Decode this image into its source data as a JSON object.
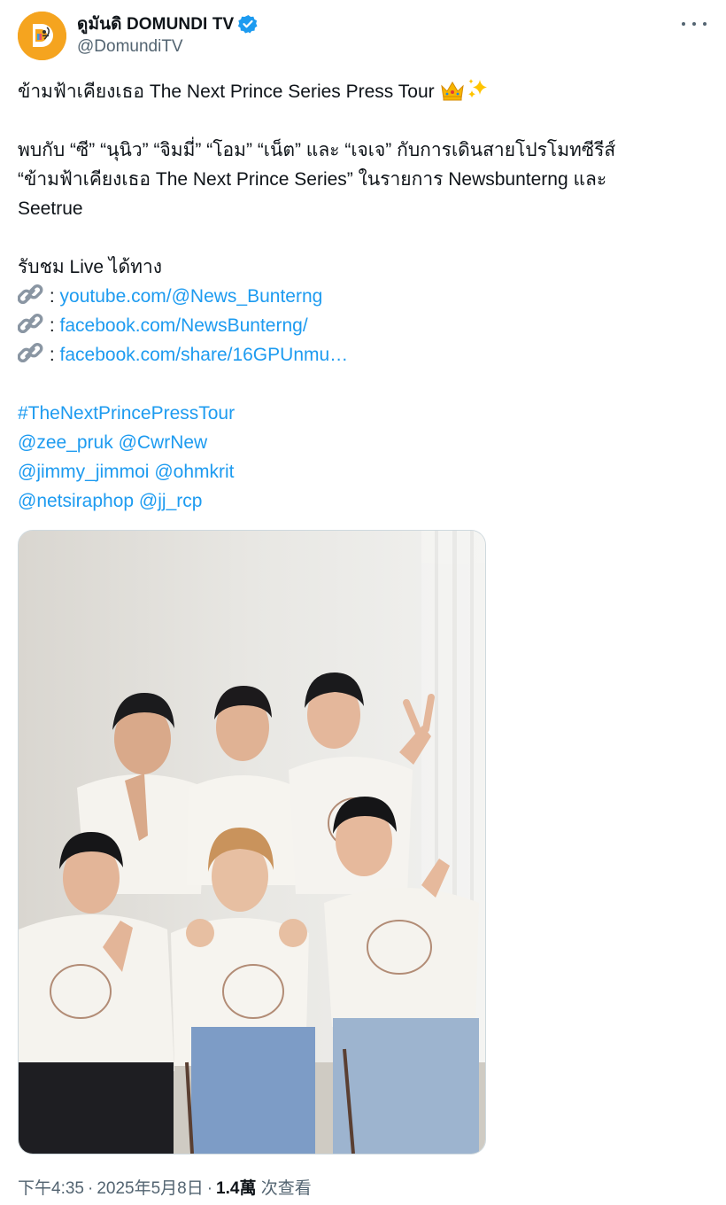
{
  "colors": {
    "link": "#1d9bf0",
    "secondary_text": "#536471",
    "primary_text": "#0f1419",
    "verified_badge": "#1d9bf0",
    "avatar_bg": "#f5a41f"
  },
  "author": {
    "display_name": "ดูมันดิ DOMUNDI TV",
    "handle": "@DomundiTV",
    "verified": true,
    "avatar_icon": "domundi-logo"
  },
  "tweet": {
    "line1": "ข้ามฟ้าเคียงเธอ The Next Prince Series Press Tour",
    "line1_emojis": [
      "crown",
      "sparkles"
    ],
    "para2": [
      "พบกับ “ซี” “นุนิว” “จิมมี่” “โอม” “เน็ต” และ “เจเจ” กับการเดินสายโปรโมทซีรีส์",
      "“ข้ามฟ้าเคียงเธอ The Next Prince Series” ในรายการ Newsbunterng และ",
      "Seetrue"
    ],
    "watch_label": "รับชม Live ได้ทาง",
    "link_separator": " : ",
    "links": [
      "youtube.com/@News_Bunterng",
      "facebook.com/NewsBunterng/",
      "facebook.com/share/16GPUnmu…"
    ],
    "hashtag": "#TheNextPrincePressTour",
    "mentions": [
      [
        "@zee_pruk",
        "@CwrNew"
      ],
      [
        "@jimmy_jimmoi",
        "@ohmkrit"
      ],
      [
        "@netsiraphop",
        "@jj_rcp"
      ]
    ]
  },
  "meta": {
    "time": "下午4:35",
    "separator": "·",
    "date": "2025年5月8日",
    "views_count": "1.4萬",
    "views_label": "次查看"
  }
}
